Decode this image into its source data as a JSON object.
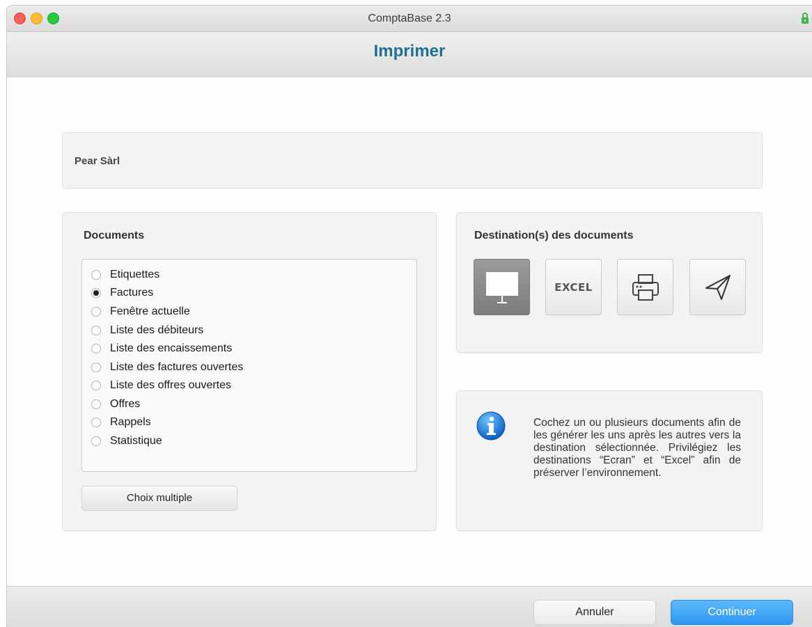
{
  "window": {
    "title": "ComptaBase 2.3"
  },
  "header": {
    "title": "Imprimer"
  },
  "company": {
    "name": "Pear Sàrl"
  },
  "documents": {
    "title": "Documents",
    "options": [
      {
        "label": "Etiquettes",
        "selected": false
      },
      {
        "label": "Factures",
        "selected": true
      },
      {
        "label": "Fenêtre actuelle",
        "selected": false
      },
      {
        "label": "Liste des débiteurs",
        "selected": false
      },
      {
        "label": "Liste des encaissements",
        "selected": false
      },
      {
        "label": "Liste des factures ouvertes",
        "selected": false
      },
      {
        "label": "Liste des offres ouvertes",
        "selected": false
      },
      {
        "label": "Offres",
        "selected": false
      },
      {
        "label": "Rappels",
        "selected": false
      },
      {
        "label": "Statistique",
        "selected": false
      }
    ],
    "multi_button": "Choix multiple"
  },
  "destination": {
    "title": "Destination(s) des documents",
    "buttons": [
      {
        "icon": "screen-icon",
        "active": true
      },
      {
        "icon": "excel-icon",
        "label": "EXCEL",
        "active": false
      },
      {
        "icon": "printer-icon",
        "active": false
      },
      {
        "icon": "send-icon",
        "active": false
      }
    ]
  },
  "info": {
    "text": "Cochez un ou plusieurs documents afin de les générer les uns après les autres vers la destination sélectionnée. Privilégiez les destinations “Ecran” et “Excel” afin de préserver l’environnement."
  },
  "footer": {
    "cancel": "Annuler",
    "continue": "Continuer"
  },
  "colors": {
    "accent": "#1f6f95",
    "primary_button": "#2d97f4"
  }
}
